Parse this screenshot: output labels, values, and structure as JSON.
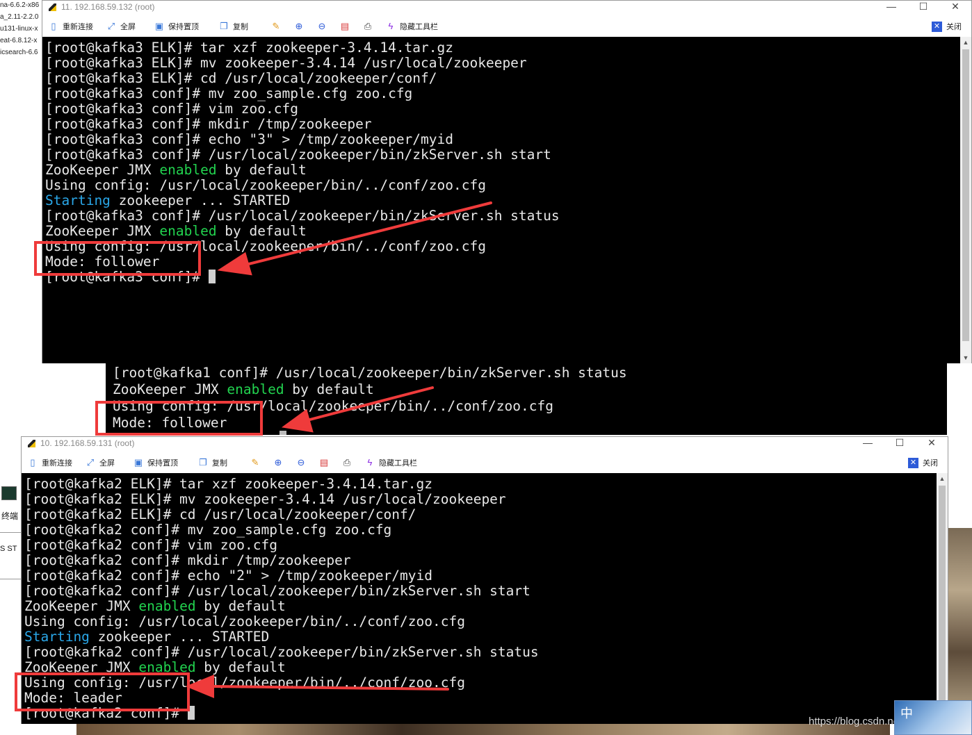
{
  "background": {
    "files": [
      "na-6.6.2-x86",
      "a_2.11-2.2.0",
      "u131-linux-x",
      "eat-6.8.12-x",
      "icsearch-6.6"
    ],
    "terminal_label": "终端",
    "tab_labels": [
      "S",
      "ST"
    ]
  },
  "window_top": {
    "title": "11. 192.168.59.132 (root)",
    "controls": {
      "minimize": "—",
      "maximize": "☐",
      "close": "✕"
    },
    "toolbar": {
      "reconnect": "重新连接",
      "fullscreen": "全屏",
      "keep_on_top": "保持置顶",
      "copy": "复制",
      "hide_toolbar": "隐藏工具栏",
      "close": "关闭"
    },
    "terminal_lines": [
      "[root@kafka3 ELK]# tar xzf zookeeper-3.4.14.tar.gz",
      "[root@kafka3 ELK]# mv zookeeper-3.4.14 /usr/local/zookeeper",
      "[root@kafka3 ELK]# cd /usr/local/zookeeper/conf/",
      "[root@kafka3 conf]# mv zoo_sample.cfg zoo.cfg",
      "[root@kafka3 conf]# vim zoo.cfg",
      "[root@kafka3 conf]# mkdir /tmp/zookeeper",
      "[root@kafka3 conf]# echo \"3\" > /tmp/zookeeper/myid",
      "[root@kafka3 conf]# /usr/local/zookeeper/bin/zkServer.sh start"
    ],
    "jmx_prefix": "ZooKeeper JMX ",
    "jmx_enabled": "enabled",
    "jmx_suffix": " by default",
    "using_config": "Using config: /usr/local/zookeeper/bin/../conf/zoo.cfg",
    "starting_word": "Starting",
    "starting_rest": " zookeeper ... STARTED",
    "status_cmd": "[root@kafka3 conf]# /usr/local/zookeeper/bin/zkServer.sh status",
    "mode_line": "Mode: follower",
    "prompt": "[root@kafka3 conf]# "
  },
  "terminal_middle": {
    "status_cmd": "[root@kafka1 conf]# /usr/local/zookeeper/bin/zkServer.sh status",
    "jmx_prefix": "ZooKeeper JMX ",
    "jmx_enabled": "enabled",
    "jmx_suffix": " by default",
    "using_config": "Using config: /usr/local/zookeeper/bin/../conf/zoo.cfg",
    "mode_line": "Mode: follower"
  },
  "window_bottom": {
    "title": "10. 192.168.59.131 (root)",
    "controls": {
      "minimize": "—",
      "maximize": "☐",
      "close": "✕"
    },
    "toolbar": {
      "reconnect": "重新连接",
      "fullscreen": "全屏",
      "keep_on_top": "保持置顶",
      "copy": "复制",
      "hide_toolbar": "隐藏工具栏",
      "close": "关闭"
    },
    "terminal_lines": [
      "[root@kafka2 ELK]# tar xzf zookeeper-3.4.14.tar.gz",
      "[root@kafka2 ELK]# mv zookeeper-3.4.14 /usr/local/zookeeper",
      "[root@kafka2 ELK]# cd /usr/local/zookeeper/conf/",
      "[root@kafka2 conf]# mv zoo_sample.cfg zoo.cfg",
      "[root@kafka2 conf]# vim zoo.cfg",
      "[root@kafka2 conf]# mkdir /tmp/zookeeper",
      "[root@kafka2 conf]# echo \"2\" > /tmp/zookeeper/myid",
      "[root@kafka2 conf]# /usr/local/zookeeper/bin/zkServer.sh start"
    ],
    "jmx_prefix": "ZooKeeper JMX ",
    "jmx_enabled": "enabled",
    "jmx_suffix": " by default",
    "using_config": "Using config: /usr/local/zookeeper/bin/../conf/zoo.cfg",
    "starting_word": "Starting",
    "starting_rest": " zookeeper ... STARTED",
    "status_cmd": "[root@kafka2 conf]# /usr/local/zookeeper/bin/zkServer.sh status",
    "mode_line": "Mode: leader",
    "prompt": "[root@kafka2 conf]# "
  },
  "watermark": "https://blog.csdn.net/APPLEaaq",
  "logo_text": "中",
  "colors": {
    "annotation_red": "#ef3b3b",
    "terminal_green": "#22d34f",
    "terminal_cyan": "#2aa7e8"
  }
}
